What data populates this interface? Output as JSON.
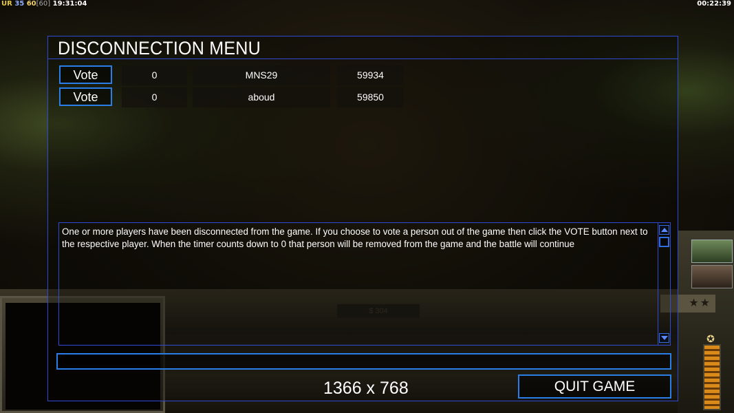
{
  "status_bar": {
    "ur": "UR",
    "fps": "35",
    "fps_target": "60",
    "fps_limit": "[60]",
    "clock": "19:31:04",
    "game_time": "00:22:39"
  },
  "menu": {
    "title": "DISCONNECTION MENU",
    "players": [
      {
        "vote_label": "Vote",
        "votes": "0",
        "name": "MNS29",
        "ping": "59934"
      },
      {
        "vote_label": "Vote",
        "votes": "0",
        "name": "aboud",
        "ping": "59850"
      }
    ],
    "message": "One or more players have been disconnected from the game. If you choose to vote a person out of the game then click the VOTE button next to the respective player. When the timer counts down to 0 that person will be removed from the game and the battle will continue",
    "chat_value": "",
    "quit_label": "QUIT GAME"
  },
  "background": {
    "money": "$ 304",
    "rank_stars": "★★"
  },
  "overlay": {
    "resolution": "1366 x 768"
  }
}
